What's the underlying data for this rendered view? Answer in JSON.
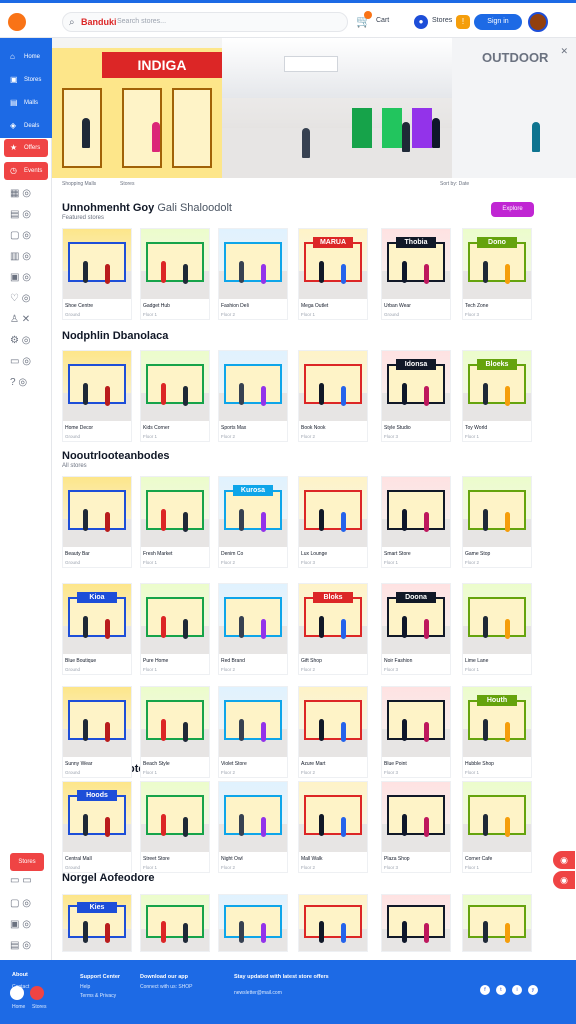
{
  "header": {
    "search_brand": "Banduki",
    "search_placeholder": "Search stores...",
    "cart_label": "Cart",
    "location_label": "Stores",
    "signin_label": "Sign in"
  },
  "sidebar": {
    "items": [
      {
        "label": "Home"
      },
      {
        "label": "Stores"
      },
      {
        "label": "Malls"
      },
      {
        "label": "Deals"
      },
      {
        "label": "Offers"
      },
      {
        "label": "Events"
      }
    ],
    "cta_label": "Stores"
  },
  "hero": {
    "left_sign": "INDIGA",
    "right_sign": "OUTDOOR"
  },
  "breadcrumb": {
    "left": "Shopping Malls",
    "middle": "Stores",
    "right": "Sort by: Date"
  },
  "sections": [
    {
      "title": "Unnohmenht Goy",
      "subtitle": "Gali Shaloodolt",
      "caption": "Featured stores",
      "button": "Explore"
    },
    {
      "title": "Nodphlin Dbanolaca"
    },
    {
      "title": "Nooutrlooteanbodes",
      "caption": "All stores"
    },
    {
      "title": "Dooonobrodotes"
    },
    {
      "title": "Norgel Aofeodore"
    }
  ],
  "cards": [
    {
      "title": "Shoe Centre",
      "meta": "Ground",
      "sign": ""
    },
    {
      "title": "Gadget Hub",
      "meta": "Floor 1",
      "sign": ""
    },
    {
      "title": "Fashion Deli",
      "meta": "Floor 2",
      "sign": ""
    },
    {
      "title": "Mega Outlet",
      "meta": "Floor 1",
      "sign": "MARUA"
    },
    {
      "title": "Urban Wear",
      "meta": "Ground",
      "sign": "Thobia"
    },
    {
      "title": "Tech Zone",
      "meta": "Floor 3",
      "sign": "Dono"
    },
    {
      "title": "Home Decor",
      "meta": "Ground"
    },
    {
      "title": "Kids Corner",
      "meta": "Floor 1"
    },
    {
      "title": "Sports Max",
      "meta": "Floor 2"
    },
    {
      "title": "Book Nook",
      "meta": "Floor 2"
    },
    {
      "title": "Style Studio",
      "meta": "Floor 3",
      "sign": "Idonsa"
    },
    {
      "title": "Toy World",
      "meta": "Floor 1",
      "sign": "Bloeks"
    },
    {
      "title": "Beauty Bar",
      "meta": "Ground"
    },
    {
      "title": "Fresh Market",
      "meta": "Floor 1"
    },
    {
      "title": "Denim Co",
      "meta": "Floor 2",
      "sign": "Kurosa"
    },
    {
      "title": "Lux Lounge",
      "meta": "Floor 3"
    },
    {
      "title": "Smart Store",
      "meta": "Floor 1"
    },
    {
      "title": "Game Stop",
      "meta": "Floor 2"
    },
    {
      "title": "Blue Boutique",
      "meta": "Ground",
      "sign": "Kioa"
    },
    {
      "title": "Pure Home",
      "meta": "Floor 1"
    },
    {
      "title": "Red Brand",
      "meta": "Floor 2"
    },
    {
      "title": "Gift Shop",
      "meta": "Floor 2",
      "sign": "Bloks"
    },
    {
      "title": "Noir Fashion",
      "meta": "Floor 3",
      "sign": "Doona"
    },
    {
      "title": "Lime Lane",
      "meta": "Floor 1"
    },
    {
      "title": "Sunny Wear",
      "meta": "Ground"
    },
    {
      "title": "Beach Style",
      "meta": "Floor 1"
    },
    {
      "title": "Violet Store",
      "meta": "Floor 2"
    },
    {
      "title": "Azure Mart",
      "meta": "Floor 2"
    },
    {
      "title": "Blue Point",
      "meta": "Floor 3"
    },
    {
      "title": "Hubble Shop",
      "meta": "Floor 1",
      "sign": "Houth"
    },
    {
      "title": "Central Mall",
      "meta": "Ground",
      "sign": "Hoods"
    },
    {
      "title": "Street Store",
      "meta": "Floor 1"
    },
    {
      "title": "Night Owl",
      "meta": "Floor 2"
    },
    {
      "title": "Mall Walk",
      "meta": "Floor 2"
    },
    {
      "title": "Plaza Shop",
      "meta": "Floor 3"
    },
    {
      "title": "Corner Cafe",
      "meta": "Floor 1"
    },
    {
      "title": "Blue Harbor",
      "meta": "Ground",
      "sign": "Kies"
    },
    {
      "title": "Clear View",
      "meta": "Floor 1"
    },
    {
      "title": "Galleria",
      "meta": "Floor 2"
    },
    {
      "title": "Atrium",
      "meta": "Floor 2"
    },
    {
      "title": "Ruby Store",
      "meta": "Floor 3"
    },
    {
      "title": "Amber Home",
      "meta": "Floor 1"
    }
  ],
  "footer": {
    "col1_head": "About",
    "col1_items": [
      "Contact"
    ],
    "col2_head": "Support Center",
    "col2_items": [
      "Help",
      "Terms & Privacy"
    ],
    "col3_head": "Download our app",
    "col3_items": [
      "Connect with us: SHOP"
    ],
    "col4_head": "Stay updated with latest store offers",
    "col4_items": [
      "newsletter@mail.com"
    ],
    "bottom_left": [
      "Home",
      "Stores"
    ]
  },
  "colors": {
    "primary": "#1d6ae5",
    "accent_red": "#ef4444",
    "accent_purple": "#c026d3"
  }
}
